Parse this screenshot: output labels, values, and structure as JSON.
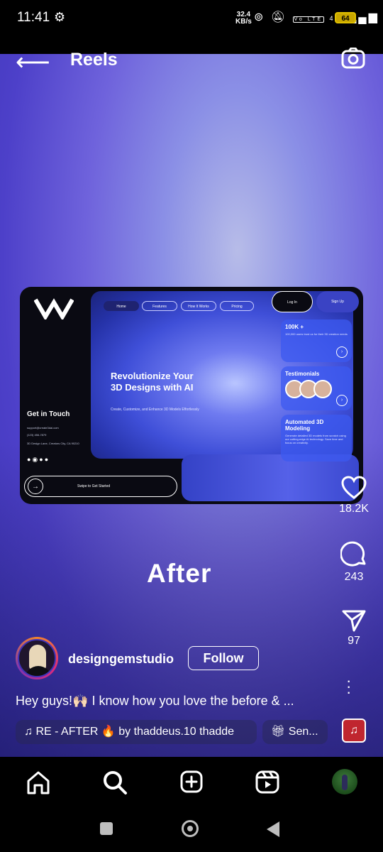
{
  "status_bar": {
    "time": "11:41",
    "net_speed_value": "32.4",
    "net_speed_unit": "KB/s",
    "network": "4G",
    "volte": "Vo LTE",
    "battery": "64"
  },
  "header": {
    "title": "Reels"
  },
  "mockup": {
    "nav_home": "Home",
    "nav_features": "Features",
    "nav_how": "How It Works",
    "nav_pricing": "Pricing",
    "login": "Log In",
    "signup": "Sign Up",
    "headline": "Revolutionize Your 3D Designs with AI",
    "subheadline": "Create, Customize, and Enhance 3D Models Effortlessly",
    "card1_title": "100K +",
    "card1_desc": "100,000 users trust us for their 3D creation needs",
    "card2_title": "Testimonials",
    "card3_title": "Automated 3D Modeling",
    "card3_desc": "Generate detailed 3D models from scratch using our cutting-edge AI technology. Save time and focus on creativity.",
    "get_in_touch": "Get in Touch",
    "email": "support@create3dai.com",
    "phone": "(123) 456-7879",
    "address": "3D Design Lane, Creators City, CA 90210",
    "swipe": "Swipe to Get Started"
  },
  "overlay_text": "After",
  "actions": {
    "likes": "18.2K",
    "comments": "243",
    "shares": "97"
  },
  "author": {
    "username": "designgemstudio",
    "follow_label": "Follow"
  },
  "caption": "Hey guys!🙌🏻 I know how you love the before & ...",
  "audio": {
    "label": "RE - AFTER 🔥 by thaddeus.10     thadde",
    "send_chip": "Sen..."
  },
  "bottom_nav": [
    "home",
    "search",
    "create",
    "reels",
    "profile"
  ],
  "colors": {
    "background": "#000000",
    "reel_gradient_top": "#8b90e6",
    "reel_gradient_bottom": "#3b32b3",
    "battery": "#c9a700",
    "music_art": "#c0262f"
  }
}
